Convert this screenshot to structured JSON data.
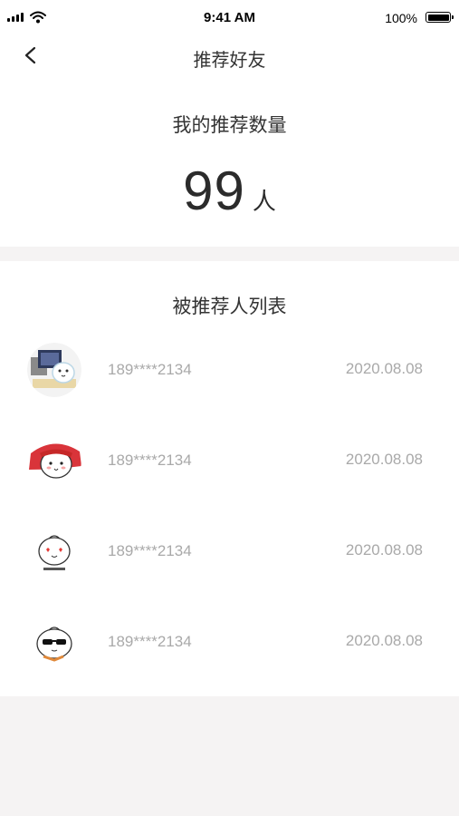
{
  "status_bar": {
    "time": "9:41 AM",
    "battery": "100%"
  },
  "nav": {
    "title": "推荐好友",
    "back_icon": "chevron-left-icon"
  },
  "summary": {
    "label": "我的推荐数量",
    "count": "99",
    "unit": "人"
  },
  "list": {
    "title": "被推荐人列表",
    "items": [
      {
        "phone": "189****2134",
        "date": "2020.08.08",
        "avatar": "cartoon-at-computer"
      },
      {
        "phone": "189****2134",
        "date": "2020.08.08",
        "avatar": "cartoon-with-headband"
      },
      {
        "phone": "189****2134",
        "date": "2020.08.08",
        "avatar": "cartoon-heart-eyes"
      },
      {
        "phone": "189****2134",
        "date": "2020.08.08",
        "avatar": "cartoon-sunglasses"
      }
    ]
  }
}
